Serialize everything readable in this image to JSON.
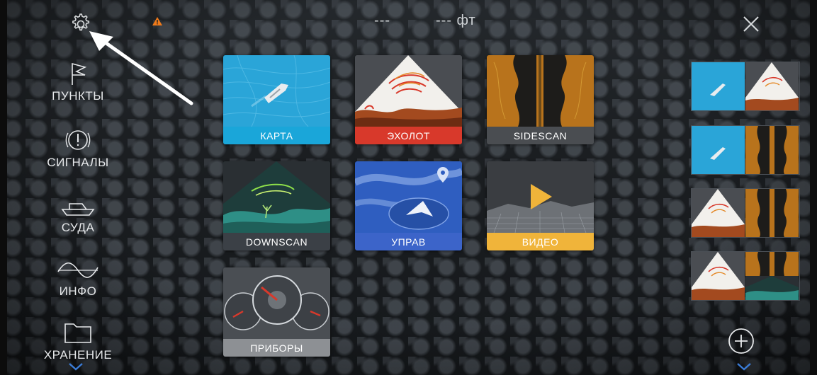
{
  "topbar": {
    "value_a": "---",
    "value_b": "--- фт"
  },
  "sidebar": {
    "items": [
      {
        "label": "ПУНКТЫ",
        "icon": "flag-icon"
      },
      {
        "label": "СИГНАЛЫ",
        "icon": "alarm-icon"
      },
      {
        "label": "СУДА",
        "icon": "boat-icon"
      },
      {
        "label": "ИНФО",
        "icon": "wave-icon"
      },
      {
        "label": "ХРАНЕНИЕ",
        "icon": "folder-icon"
      }
    ]
  },
  "tiles": [
    {
      "label": "КАРТА",
      "color": "#1aa6d9"
    },
    {
      "label": "ЭХОЛОТ",
      "color": "#d8392b"
    },
    {
      "label": "SIDESCAN",
      "color": "#4a4d51"
    },
    {
      "label": "DOWNSCAN",
      "color": "#3b4046"
    },
    {
      "label": "УПРАВ",
      "color": "#3c64c9"
    },
    {
      "label": "ВИДЕО",
      "color": "#f0b43a"
    },
    {
      "label": "ПРИБОРЫ",
      "color": "#8d9094"
    }
  ],
  "icons": {
    "settings": "gear-icon",
    "warning": "warning-icon",
    "close": "close-icon",
    "add": "plus-circle-icon"
  },
  "colors": {
    "accent_blue": "#3a7bd5",
    "warning": "#f07a1a"
  }
}
